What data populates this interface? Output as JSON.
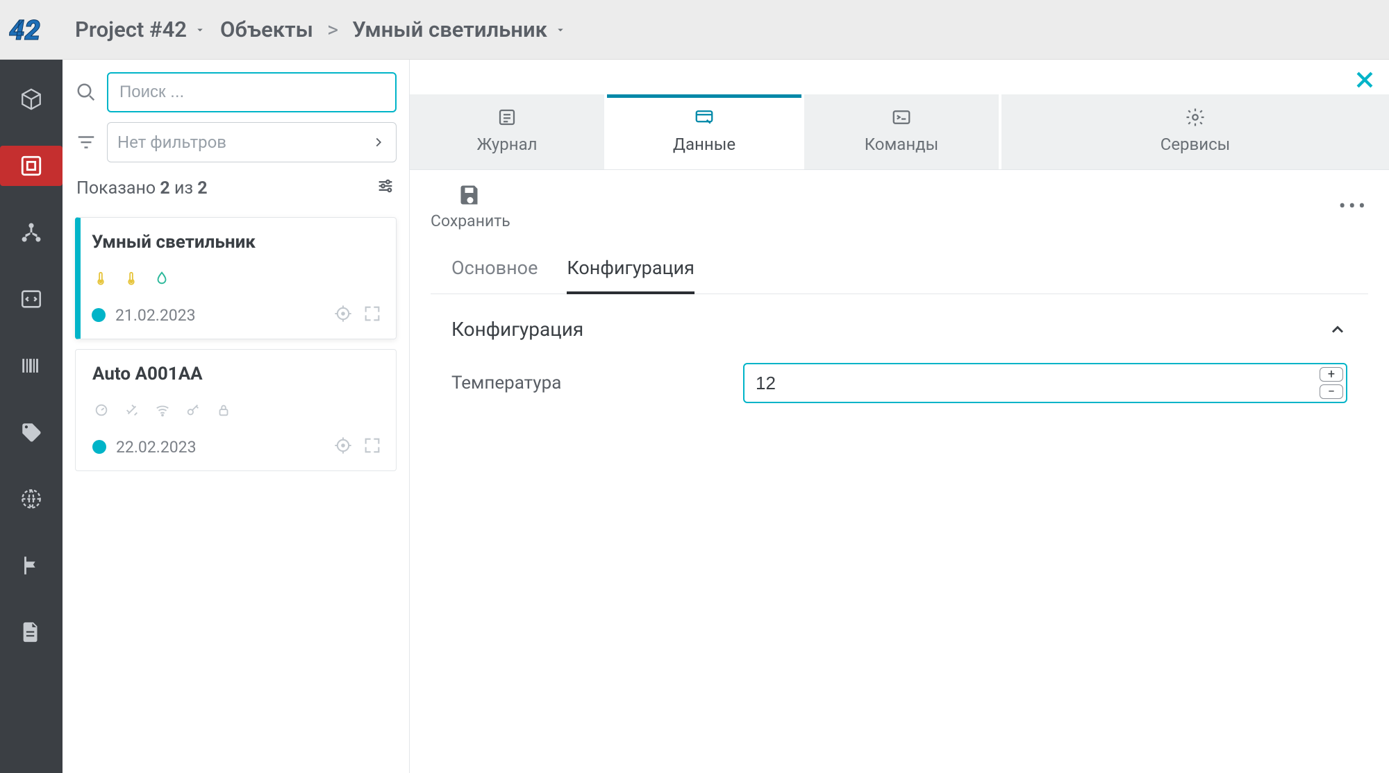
{
  "breadcrumb": {
    "project": "Project #42",
    "objects": "Объекты",
    "current": "Умный светильник"
  },
  "list": {
    "search_placeholder": "Поиск ...",
    "filter_placeholder": "Нет фильтров",
    "count_prefix": "Показано",
    "count_shown": "2",
    "count_of": "из",
    "count_total": "2"
  },
  "cards": [
    {
      "title": "Умный светильник",
      "date": "21.02.2023"
    },
    {
      "title": "Auto A001AA",
      "date": "22.02.2023"
    }
  ],
  "tabs": {
    "t0": "Журнал",
    "t1": "Данные",
    "t2": "Команды",
    "t3": "Сервисы"
  },
  "toolbar": {
    "save": "Сохранить"
  },
  "subtabs": {
    "s0": "Основное",
    "s1": "Конфигурация"
  },
  "section": {
    "title": "Конфигурация"
  },
  "field": {
    "label": "Температура",
    "value": "12"
  }
}
